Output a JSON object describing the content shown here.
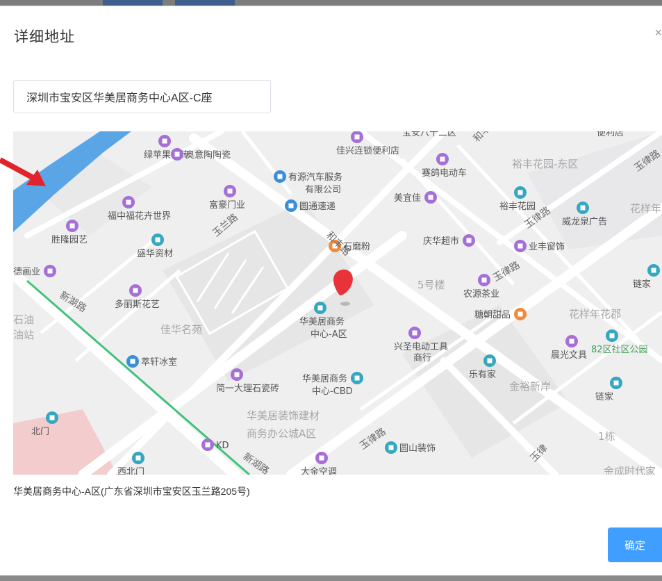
{
  "dialog": {
    "title": "详细地址",
    "close_glyph": "×",
    "address_value": "深圳市宝安区华美居商务中心A区-C座",
    "result_text": "华美居商务中心-A区(广东省深圳市宝安区玉兰路205号)",
    "confirm_label": "确定"
  },
  "colors": {
    "accent": "#409eff",
    "marker": "#e8333b",
    "annotation_arrow": "#e3232b",
    "poi_purple": "#a66fd6",
    "poi_blue": "#3a8fd8",
    "poi_orange": "#f08a3c",
    "poi_teal": "#35a7c1",
    "river": "#5aa5e6",
    "green_line": "#42c27a"
  },
  "map": {
    "pois": [
      {
        "label": "绿苹果瓷砖",
        "icon": "shop-icon"
      },
      {
        "label": "奥意陶陶瓷",
        "icon": "shop-icon"
      },
      {
        "label": "佳兴连锁便利店",
        "icon": "shop-icon"
      },
      {
        "label": "宝安八十二区",
        "icon": "bus-icon"
      },
      {
        "label": "便利店",
        "icon": "shop-icon"
      },
      {
        "label": "赛鸽电动车",
        "icon": "shop-icon"
      },
      {
        "label": "裕丰花园-东区",
        "icon": "area-label"
      },
      {
        "label": "有源汽车服务",
        "icon": "car-icon"
      },
      {
        "label": "有限公司",
        "icon": "car-icon"
      },
      {
        "label": "富豪门业",
        "icon": "shop-icon"
      },
      {
        "label": "福中福花卉世界",
        "icon": "shop-icon"
      },
      {
        "label": "圆通速递",
        "icon": "delivery-icon"
      },
      {
        "label": "美宜佳",
        "icon": "shop-icon"
      },
      {
        "label": "裕丰花园",
        "icon": "building-icon"
      },
      {
        "label": "威龙泉广告",
        "icon": "building-icon"
      },
      {
        "label": "花样年",
        "icon": "area-label"
      },
      {
        "label": "胜隆园艺",
        "icon": "shop-icon"
      },
      {
        "label": "盛华资材",
        "icon": "place-icon"
      },
      {
        "label": "石磨粉",
        "icon": "food-icon"
      },
      {
        "label": "庆华超市",
        "icon": "shop-icon"
      },
      {
        "label": "业丰窗饰",
        "icon": "shop-icon"
      },
      {
        "label": "德画业",
        "icon": "shop-icon"
      },
      {
        "label": "5号楼",
        "icon": "area-label"
      },
      {
        "label": "农源茶业",
        "icon": "shop-icon"
      },
      {
        "label": "链家",
        "icon": "building-icon"
      },
      {
        "label": "多丽斯花艺",
        "icon": "shop-icon"
      },
      {
        "label": "糖朝甜品",
        "icon": "food-icon"
      },
      {
        "label": "花样年花郡",
        "icon": "area-label"
      },
      {
        "label": "石油",
        "icon": "area-label"
      },
      {
        "label": "油站",
        "icon": "area-label"
      },
      {
        "label": "佳华名苑",
        "icon": "area-label"
      },
      {
        "label": "华美居商务",
        "icon": "building-icon"
      },
      {
        "label": "中心-A区",
        "icon": "building-icon"
      },
      {
        "label": "兴圣电动工具",
        "icon": "shop-icon"
      },
      {
        "label": "商行",
        "icon": "shop-icon"
      },
      {
        "label": "晨光文具",
        "icon": "shop-icon"
      },
      {
        "label": "82区社区公园",
        "icon": "park-icon"
      },
      {
        "label": "萃轩冰室",
        "icon": "bus-icon"
      },
      {
        "label": "简一大理石瓷砖",
        "icon": "shop-icon"
      },
      {
        "label": "华美居商务",
        "icon": "building-icon"
      },
      {
        "label": "中心-CBD",
        "icon": "building-icon"
      },
      {
        "label": "乐有家",
        "icon": "building-icon"
      },
      {
        "label": "金裕新岸",
        "icon": "area-label"
      },
      {
        "label": "链家",
        "icon": "building-icon"
      },
      {
        "label": "华美居装饰建材",
        "icon": "area-label"
      },
      {
        "label": "商务办公城A区",
        "icon": "area-label"
      },
      {
        "label": "北门",
        "icon": "gate-icon"
      },
      {
        "label": "KD",
        "icon": "shop-icon"
      },
      {
        "label": "圆山装饰",
        "icon": "building-icon"
      },
      {
        "label": "1栋",
        "icon": "area-label"
      },
      {
        "label": "西北门",
        "icon": "gate-icon"
      },
      {
        "label": "大金空调",
        "icon": "shop-icon"
      },
      {
        "label": "金成时代家",
        "icon": "area-label"
      }
    ],
    "roads": [
      "玉兰路",
      "和丰路",
      "新湖路",
      "新湖路",
      "玉律路",
      "玉律路",
      "玉律路",
      "和丰路",
      "玉律路",
      "玉律"
    ]
  }
}
